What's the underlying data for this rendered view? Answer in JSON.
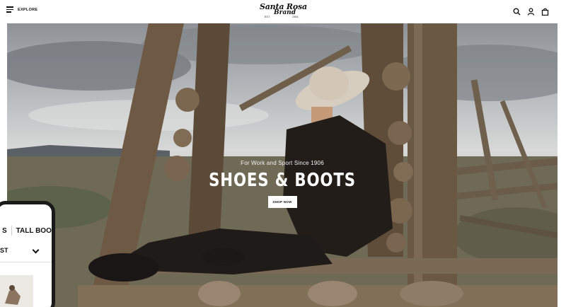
{
  "header": {
    "menu_label": "EXPLORE",
    "logo": {
      "line1": "Santa Rosa",
      "line2": "Brand",
      "est": "EST.",
      "year": "1906"
    },
    "icons": [
      "search-icon",
      "account-icon",
      "cart-icon"
    ]
  },
  "hero": {
    "eyebrow": "For Work and Sport Since 1906",
    "headline": "SHOES & BOOTS",
    "cta_label": "SHOP NOW"
  },
  "phone_preview": {
    "tab_partial": "S",
    "tab_tall": "TALL BOOT",
    "sort_partial": "ST"
  },
  "colors": {
    "header_bg": "#ffffff",
    "text": "#111111",
    "cta_bg": "#ffffff"
  }
}
